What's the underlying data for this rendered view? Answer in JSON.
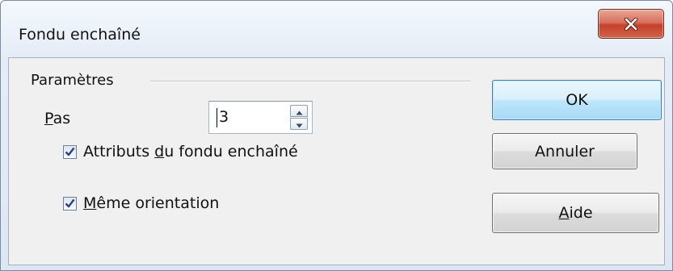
{
  "window": {
    "title": "Fondu enchaîné",
    "close_icon": "close-icon"
  },
  "group": {
    "label": "Paramètres"
  },
  "steps": {
    "label_underlined": "P",
    "label_rest": "as",
    "value": "3"
  },
  "options": {
    "crossfade_attributes": {
      "label_before": "Attributs ",
      "label_underlined": "d",
      "label_after": "u fondu enchaîné",
      "checked": true
    },
    "same_orientation": {
      "label_underlined": "M",
      "label_after": "ême orientation",
      "checked": true
    }
  },
  "buttons": {
    "ok": "OK",
    "cancel": "Annuler",
    "help_underlined": "A",
    "help_rest": "ide"
  },
  "colors": {
    "close_button": "#c4412a",
    "ok_border": "#3c7fb1",
    "checkmark": "#2a3f8f"
  }
}
